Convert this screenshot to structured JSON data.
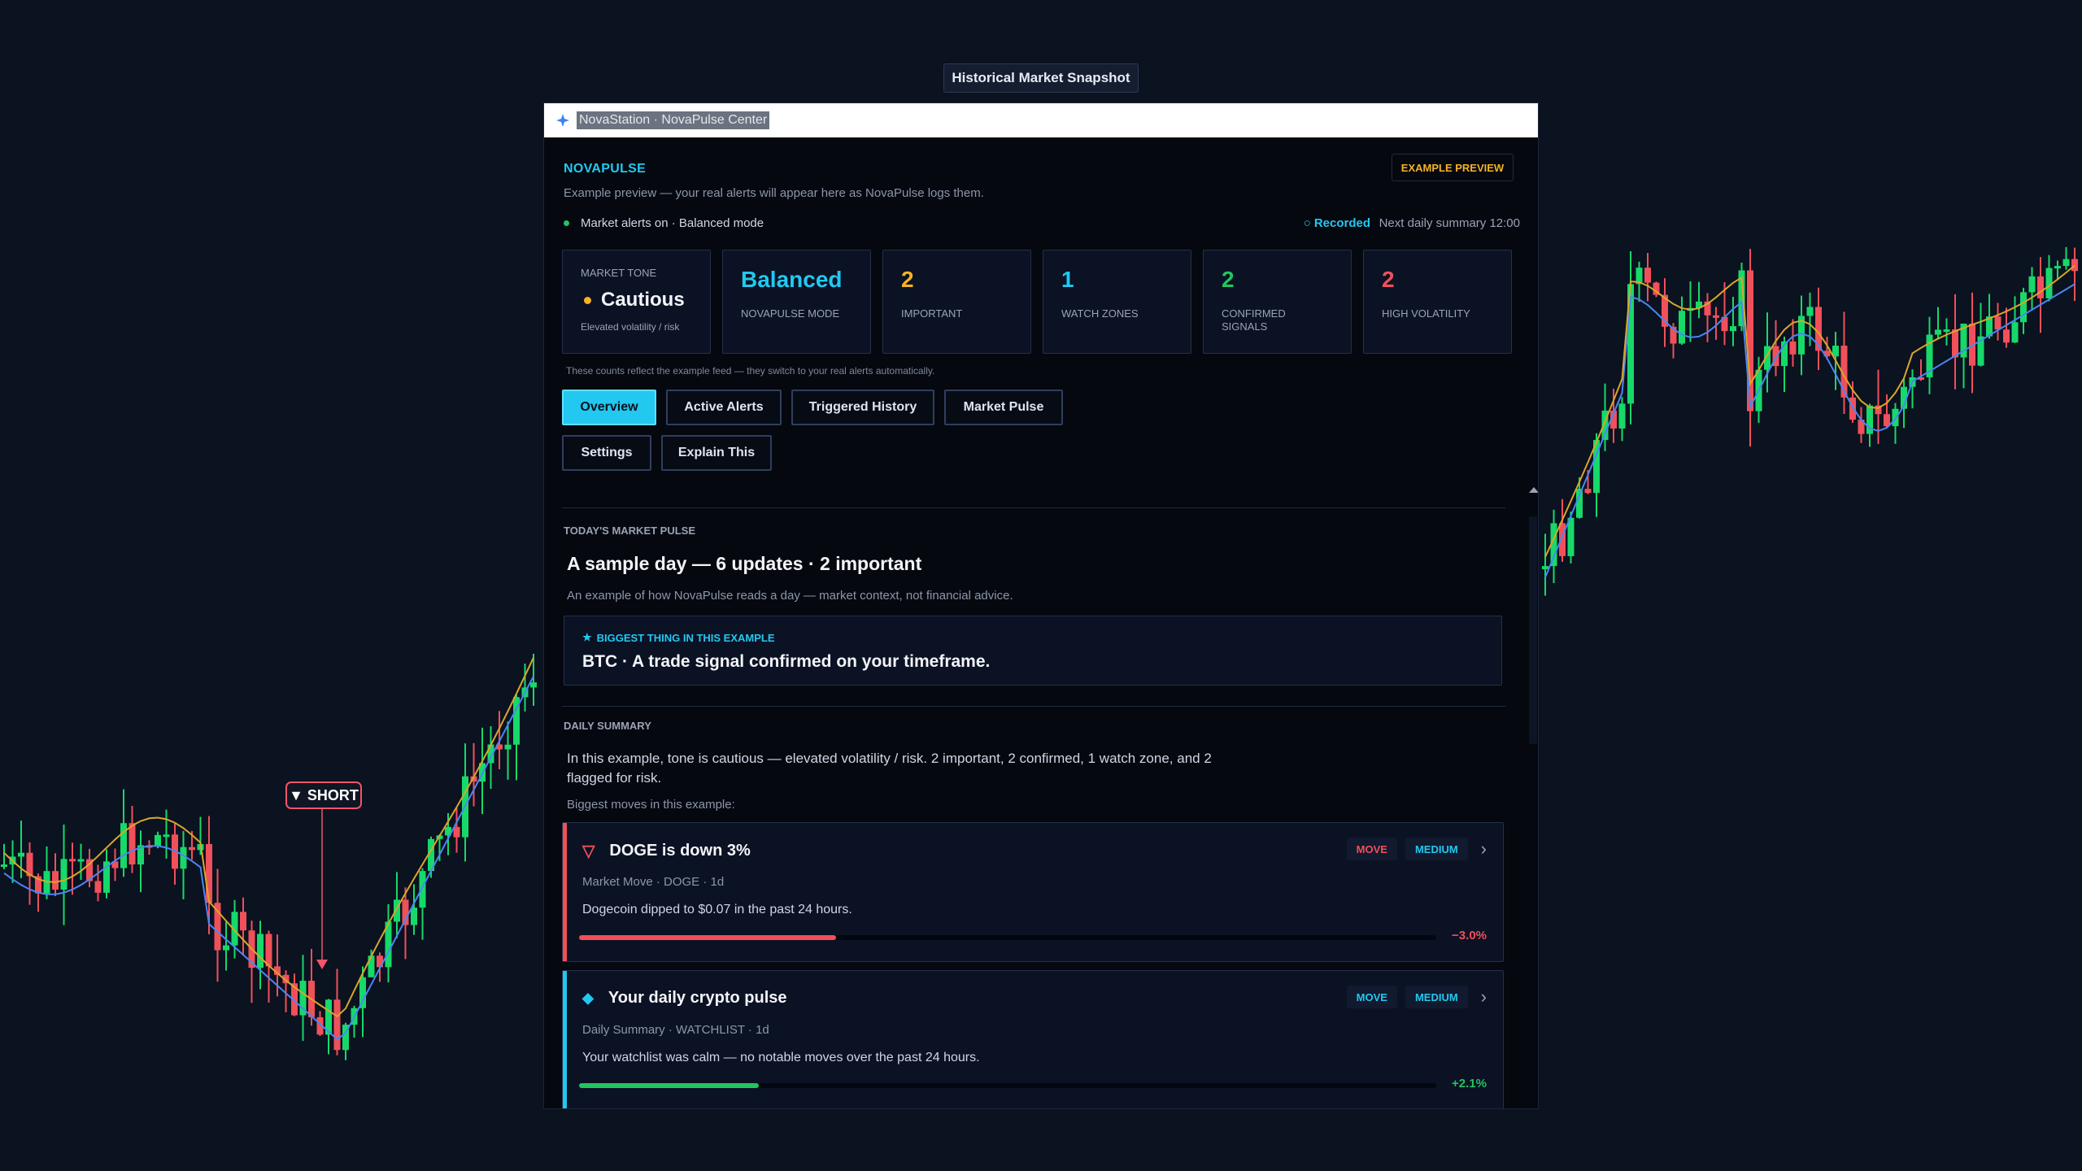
{
  "snapshot_label": "Historical Market Snapshot",
  "chart_overlay": {
    "short_label": "SHORT"
  },
  "window": {
    "title": "NovaStation · NovaPulse Center"
  },
  "header": {
    "brand": "NOVAPULSE",
    "example_badge": "EXAMPLE PREVIEW",
    "description": "Example preview — your real alerts will appear here as NovaPulse logs them.",
    "status": "Market alerts on · Balanced mode",
    "recorded": "Recorded",
    "next_summary": "Next daily summary 12:00"
  },
  "stats": {
    "tone": {
      "label": "MARKET TONE",
      "value": "Cautious",
      "sub": "Elevated volatility / risk"
    },
    "mode": {
      "value": "Balanced",
      "label": "NOVAPULSE MODE"
    },
    "important": {
      "value": "2",
      "label": "IMPORTANT"
    },
    "watch": {
      "value": "1",
      "label": "WATCH ZONES"
    },
    "confirmed": {
      "value": "2",
      "label": "CONFIRMED SIGNALS"
    },
    "volatility": {
      "value": "2",
      "label": "HIGH VOLATILITY"
    }
  },
  "counts_note": "These counts reflect the example feed — they switch to your real alerts automatically.",
  "tabs": [
    "Overview",
    "Active Alerts",
    "Triggered History",
    "Market Pulse",
    "Settings",
    "Explain This"
  ],
  "pulse": {
    "section_label": "TODAY'S MARKET PULSE",
    "headline": "A sample day — 6 updates · 2 important",
    "subtitle": "An example of how NovaPulse reads a day — market context, not financial advice.",
    "biggest_tag": "BIGGEST THING IN THIS EXAMPLE",
    "biggest_text": "BTC · A trade signal confirmed on your timeframe."
  },
  "summary": {
    "section_label": "DAILY SUMMARY",
    "text": "In this example, tone is cautious — elevated volatility / risk. 2 important, 2 confirmed, 1 watch zone, and 2 flagged for risk.",
    "moves_label": "Biggest moves in this example:"
  },
  "alerts": [
    {
      "title": "DOGE is down 3%",
      "meta": "Market Move · DOGE · 1d",
      "desc": "Dogecoin dipped to $0.07 in the past 24 hours.",
      "tag1": "MOVE",
      "tag2": "MEDIUM",
      "pct": "−3.0%",
      "fill": 0.3,
      "color": "#f0505a"
    },
    {
      "title": "Your daily crypto pulse",
      "meta": "Daily Summary · WATCHLIST · 1d",
      "desc": "Your watchlist was calm — no notable moves over the past 24 hours.",
      "tag1": "MOVE",
      "tag2": "MEDIUM",
      "pct": "+2.1%",
      "fill": 0.21,
      "color": "#22c55e"
    }
  ],
  "colors": {
    "accent": "#22c8f0",
    "up": "#16d96a",
    "down": "#f0505a",
    "warning": "#f5b323"
  }
}
